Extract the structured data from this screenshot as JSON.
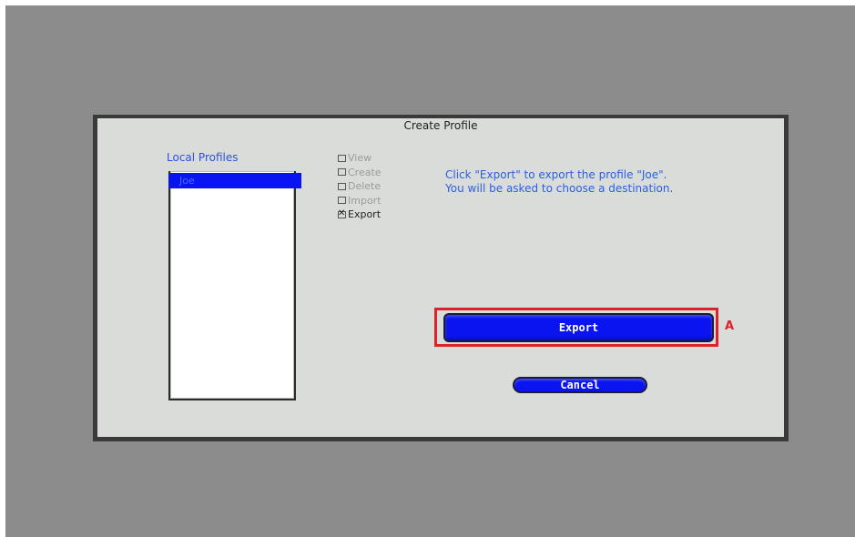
{
  "dialog": {
    "title": "Create Profile"
  },
  "profiles": {
    "label": "Local Profiles",
    "items": [
      "Joe"
    ],
    "selected": "Joe"
  },
  "actions": [
    {
      "label": "View",
      "checked": false
    },
    {
      "label": "Create",
      "checked": false
    },
    {
      "label": "Delete",
      "checked": false
    },
    {
      "label": "Import",
      "checked": false
    },
    {
      "label": "Export",
      "checked": true
    }
  ],
  "instructions": {
    "line1": "Click \"Export\" to export the profile \"Joe\".",
    "line2": "You will be asked to choose a destination."
  },
  "buttons": {
    "export_label": "Export",
    "cancel_label": "Cancel"
  },
  "annotation": {
    "label": "A",
    "color": "#e0202a"
  },
  "colors": {
    "button_blue": "#0a14f0",
    "text_blue": "#2a5fe0",
    "dialog_bg": "#d9dcd9",
    "backdrop": "#8c8c8c"
  }
}
